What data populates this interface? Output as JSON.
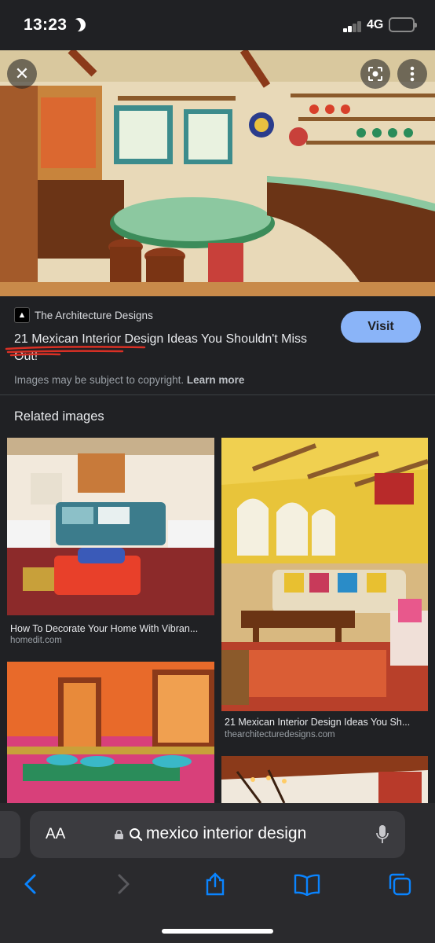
{
  "status_bar": {
    "time": "13:23",
    "network": "4G",
    "battery_color": "#ffd60a"
  },
  "hero": {
    "close_icon": "close-icon",
    "lens_icon": "lens-icon",
    "more_icon": "more-vertical-icon"
  },
  "result": {
    "source_name": "The Architecture Designs",
    "title": "21 Mexican Interior Design Ideas You Shouldn't Miss Out!",
    "visit_label": "Visit",
    "copyright_text": "Images may be subject to copyright.",
    "learn_more": "Learn more",
    "underline_color": "#d93025"
  },
  "related": {
    "heading": "Related images",
    "items": [
      {
        "title": "How To Decorate Your Home With Vibran...",
        "site": "homedit.com"
      },
      {
        "title": "21 Mexican Interior Design Ideas You Sh...",
        "site": "thearchitecturedesigns.com"
      },
      {
        "title": "",
        "site": ""
      },
      {
        "title": "",
        "site": ""
      }
    ]
  },
  "browser": {
    "aa_label": "AA",
    "address": "mexico interior design",
    "accent": "#0a84ff"
  }
}
